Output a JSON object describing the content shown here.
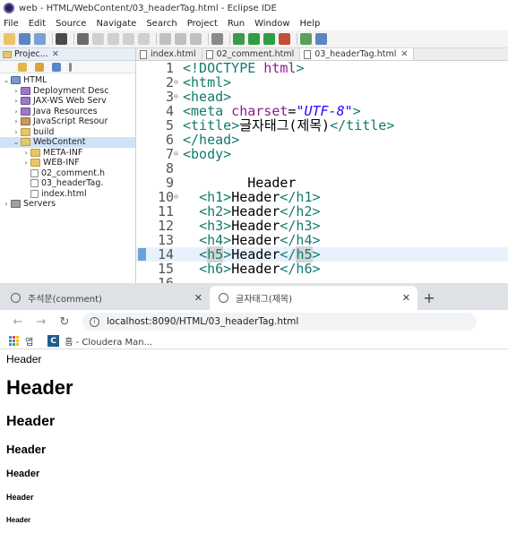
{
  "eclipse": {
    "title": "web - HTML/WebContent/03_headerTag.html - Eclipse IDE",
    "menu": [
      "File",
      "Edit",
      "Source",
      "Navigate",
      "Search",
      "Project",
      "Run",
      "Window",
      "Help"
    ],
    "explorer": {
      "tab_label": "Projec...",
      "tree": [
        {
          "label": "HTML",
          "indent": 0,
          "twisty": "open",
          "icon": "project"
        },
        {
          "label": "Deployment Desc",
          "indent": 1,
          "twisty": "closed",
          "icon": "pkg"
        },
        {
          "label": "JAX-WS Web Serv",
          "indent": 1,
          "twisty": "closed",
          "icon": "pkg"
        },
        {
          "label": "Java Resources",
          "indent": 1,
          "twisty": "closed",
          "icon": "pkg"
        },
        {
          "label": "JavaScript Resour",
          "indent": 1,
          "twisty": "closed",
          "icon": "jar"
        },
        {
          "label": "build",
          "indent": 1,
          "twisty": "closed",
          "icon": "folder"
        },
        {
          "label": "WebContent",
          "indent": 1,
          "twisty": "open",
          "icon": "folder",
          "selected": true
        },
        {
          "label": "META-INF",
          "indent": 2,
          "twisty": "closed",
          "icon": "folder"
        },
        {
          "label": "WEB-INF",
          "indent": 2,
          "twisty": "closed",
          "icon": "folder"
        },
        {
          "label": "02_comment.h",
          "indent": 2,
          "twisty": "",
          "icon": "file"
        },
        {
          "label": "03_headerTag.",
          "indent": 2,
          "twisty": "",
          "icon": "file"
        },
        {
          "label": "index.html",
          "indent": 2,
          "twisty": "",
          "icon": "file"
        },
        {
          "label": "Servers",
          "indent": 0,
          "twisty": "closed",
          "icon": "server"
        }
      ]
    },
    "editor_tabs": [
      {
        "label": "index.html",
        "active": false,
        "close": false
      },
      {
        "label": "02_comment.html",
        "active": false,
        "close": false
      },
      {
        "label": "03_headerTag.html",
        "active": true,
        "close": true
      }
    ],
    "code_lines": [
      {
        "num": "1",
        "fold": "",
        "text": "<!DOCTYPE html>"
      },
      {
        "num": "2",
        "fold": "⊖",
        "text": "<html>"
      },
      {
        "num": "3",
        "fold": "⊖",
        "text": "<head>"
      },
      {
        "num": "4",
        "fold": "",
        "text": "<meta charset=\"UTF-8\">"
      },
      {
        "num": "5",
        "fold": "",
        "text": "<title>글자태그(제목)</title>"
      },
      {
        "num": "6",
        "fold": "",
        "text": "</head>"
      },
      {
        "num": "7",
        "fold": "⊖",
        "text": "<body>"
      },
      {
        "num": "8",
        "fold": "",
        "text": ""
      },
      {
        "num": "9",
        "fold": "",
        "text": "        Header"
      },
      {
        "num": "10",
        "fold": "⊖",
        "text": "  <h1>Header</h1>"
      },
      {
        "num": "11",
        "fold": "",
        "text": "  <h2>Header</h2>"
      },
      {
        "num": "12",
        "fold": "",
        "text": "  <h3>Header</h3>"
      },
      {
        "num": "13",
        "fold": "",
        "text": "  <h4>Header</h4>"
      },
      {
        "num": "14",
        "fold": "",
        "text": "  <h5>Header</h5>",
        "current": true
      },
      {
        "num": "15",
        "fold": "",
        "text": "  <h6>Header</h6>"
      },
      {
        "num": "16",
        "fold": "",
        "text": ""
      }
    ]
  },
  "browser": {
    "tabs": [
      {
        "title": "주석문(comment)",
        "active": false
      },
      {
        "title": "글자태그(제목)",
        "active": true
      }
    ],
    "new_tab": "+",
    "address": "localhost:8090/HTML/03_headerTag.html",
    "bookmarks": [
      {
        "label": "앱",
        "icon": "apps-grid-icon"
      },
      {
        "label": "홈 - Cloudera Man...",
        "icon": "cloudera-icon"
      }
    ],
    "page": {
      "plain_text": "Header",
      "headings": [
        {
          "level": 1,
          "text": "Header"
        },
        {
          "level": 2,
          "text": "Header"
        },
        {
          "level": 3,
          "text": "Header"
        },
        {
          "level": 4,
          "text": "Header"
        },
        {
          "level": 5,
          "text": "Header"
        },
        {
          "level": 6,
          "text": "Header"
        }
      ]
    }
  }
}
